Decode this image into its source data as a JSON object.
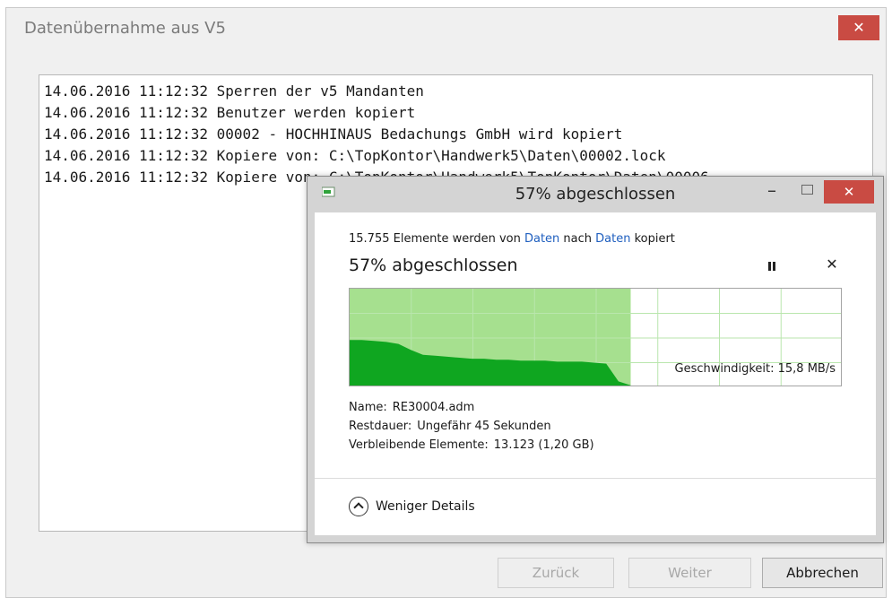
{
  "outer_window": {
    "title": "Datenübernahme aus V5",
    "close_glyph": "✕",
    "log_lines": [
      "14.06.2016 11:12:32 Sperren der v5 Mandanten",
      "14.06.2016 11:12:32 Benutzer werden kopiert",
      "14.06.2016 11:12:32 00002 - HOCHHINAUS Bedachungs GmbH wird kopiert",
      "14.06.2016 11:12:32 Kopiere von: C:\\TopKontor\\Handwerk5\\Daten\\00002.lock",
      "14.06.2016 11:12:32 Kopiere von: C:\\TopKontor\\Handwerk5\\TopKontor\\Daten\\00006"
    ],
    "buttons": {
      "back": "Zurück",
      "next": "Weiter",
      "cancel": "Abbrechen"
    }
  },
  "copy_dialog": {
    "title": "57% abgeschlossen",
    "minimize_glyph": "–",
    "close_glyph": "✕",
    "info_prefix": "15.755 Elemente werden von ",
    "info_from": "Daten",
    "info_mid": " nach ",
    "info_to": "Daten",
    "info_suffix": " kopiert",
    "status": "57% abgeschlossen",
    "cancel_glyph": "✕",
    "progress_percent": 57,
    "speed_text": "Geschwindigkeit: 15,8 MB/s",
    "details": {
      "name_label": "Name:",
      "name_value": "RE30004.adm",
      "remaining_label": "Restdauer:",
      "remaining_value": "Ungefähr 45 Sekunden",
      "items_label": "Verbleibende Elemente:",
      "items_value": "13.123 (1,20 GB)"
    },
    "toggle_label": "Weniger Details",
    "colors": {
      "progress_fill": "#a6e08f",
      "speed_fill": "#0fa620",
      "grid": "#b9e6ad",
      "close_red": "#c94b43",
      "link_blue": "#1f5fbf"
    }
  }
}
